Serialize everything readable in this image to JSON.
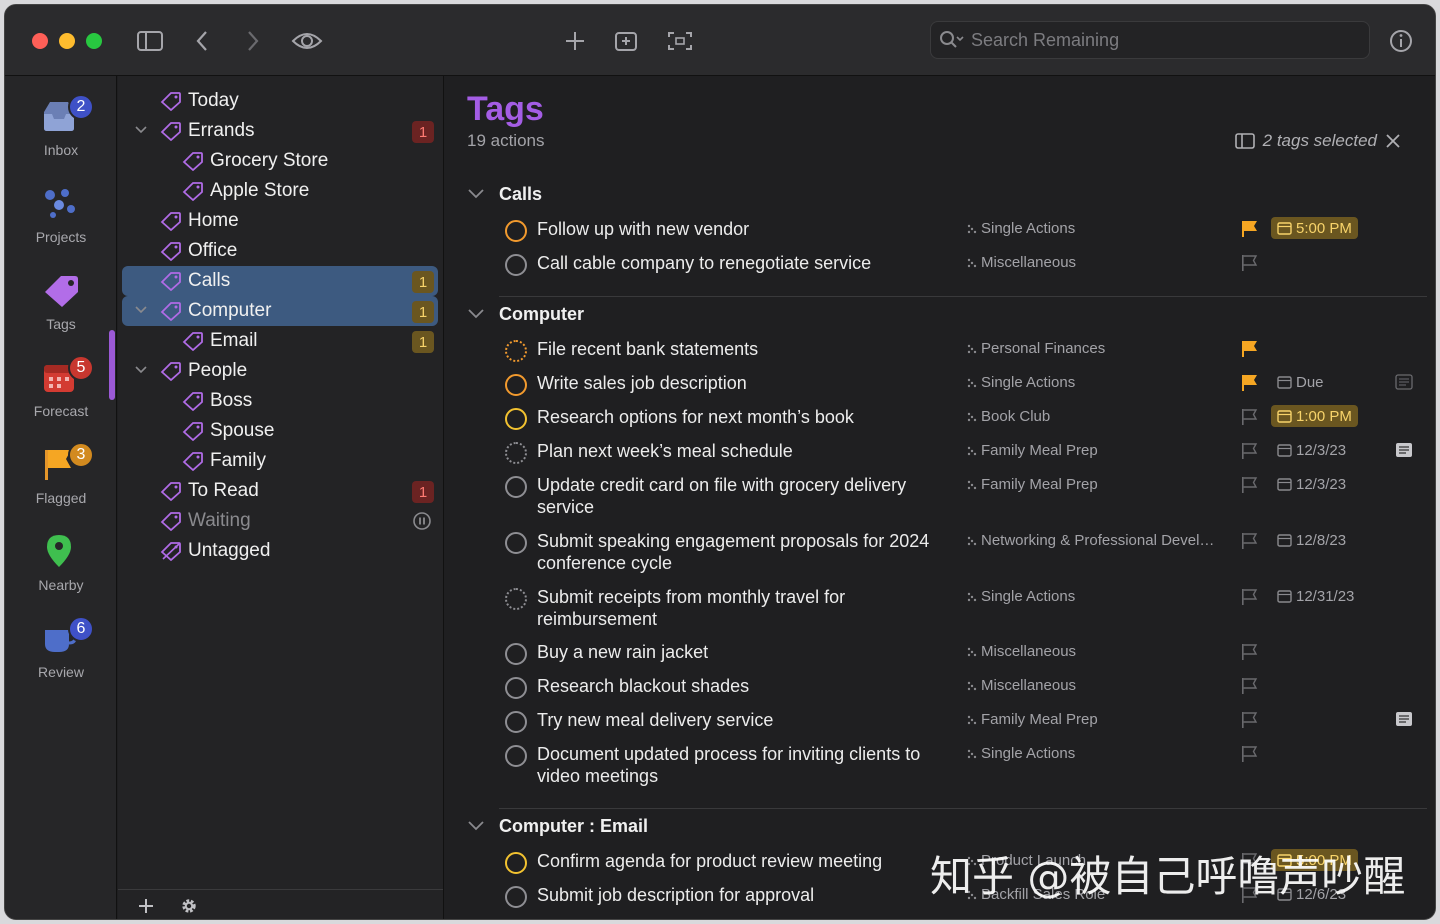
{
  "search": {
    "placeholder": "Search Remaining"
  },
  "rail": {
    "items": [
      {
        "label": "Inbox",
        "badge": "2",
        "badge_color": "#3f51c7",
        "icon": "inbox-icon"
      },
      {
        "label": "Projects",
        "badge": "",
        "icon": "projects-icon"
      },
      {
        "label": "Tags",
        "badge": "",
        "icon": "tag-icon"
      },
      {
        "label": "Forecast",
        "badge": "5",
        "badge_color": "#c8372f",
        "icon": "calendar-icon"
      },
      {
        "label": "Flagged",
        "badge": "3",
        "badge_color": "#d28a1f",
        "icon": "flag-icon"
      },
      {
        "label": "Nearby",
        "badge": "",
        "icon": "map-pin-icon"
      },
      {
        "label": "Review",
        "badge": "6",
        "badge_color": "#3f51c7",
        "icon": "review-icon"
      }
    ]
  },
  "sidebar": {
    "items": [
      {
        "label": "Today",
        "count": ""
      },
      {
        "label": "Errands",
        "count": "1"
      },
      {
        "label": "Grocery Store",
        "count": ""
      },
      {
        "label": "Apple Store",
        "count": ""
      },
      {
        "label": "Home",
        "count": ""
      },
      {
        "label": "Office",
        "count": ""
      },
      {
        "label": "Calls",
        "count": "1"
      },
      {
        "label": "Computer",
        "count": "1"
      },
      {
        "label": "Email",
        "count": "1"
      },
      {
        "label": "People",
        "count": ""
      },
      {
        "label": "Boss",
        "count": ""
      },
      {
        "label": "Spouse",
        "count": ""
      },
      {
        "label": "Family",
        "count": ""
      },
      {
        "label": "To Read",
        "count": "1"
      },
      {
        "label": "Waiting",
        "count": ""
      },
      {
        "label": "Untagged",
        "count": ""
      }
    ]
  },
  "main": {
    "title": "Tags",
    "subtitle": "19 actions",
    "selection": "2 tags selected",
    "groups": [
      {
        "name": "Calls",
        "tasks": [
          {
            "name": "Follow up with new vendor",
            "project": "Single Actions",
            "flagged": true,
            "due": "5:00 PM"
          },
          {
            "name": "Call cable company to renegotiate service",
            "project": "Miscellaneous",
            "flagged": false,
            "due": ""
          }
        ]
      },
      {
        "name": "Computer",
        "tasks": [
          {
            "name": "File recent bank statements",
            "project": "Personal Finances",
            "flagged": true,
            "due": ""
          },
          {
            "name": "Write sales job description",
            "project": "Single Actions",
            "flagged": true,
            "due": "Due"
          },
          {
            "name": "Research options for next month’s book",
            "project": "Book Club",
            "flagged": false,
            "due": "1:00 PM"
          },
          {
            "name": "Plan next week’s meal schedule",
            "project": "Family Meal Prep",
            "flagged": false,
            "due": "12/3/23"
          },
          {
            "name": "Update credit card on file with grocery delivery service",
            "project": "Family Meal Prep",
            "flagged": false,
            "due": "12/3/23"
          },
          {
            "name": "Submit speaking engagement proposals for 2024 conference cycle",
            "project": "Networking & Professional Devel…",
            "flagged": false,
            "due": "12/8/23"
          },
          {
            "name": "Submit receipts from monthly travel for reimbursement",
            "project": "Single Actions",
            "flagged": false,
            "due": "12/31/23"
          },
          {
            "name": "Buy a new rain jacket",
            "project": "Miscellaneous",
            "flagged": false,
            "due": ""
          },
          {
            "name": "Research blackout shades",
            "project": "Miscellaneous",
            "flagged": false,
            "due": ""
          },
          {
            "name": "Try new meal delivery service",
            "project": "Family Meal Prep",
            "flagged": false,
            "due": ""
          },
          {
            "name": "Document updated process for inviting clients to video meetings",
            "project": "Single Actions",
            "flagged": false,
            "due": ""
          }
        ]
      },
      {
        "name": "Computer : Email",
        "tasks": [
          {
            "name": "Confirm agenda for product review meeting",
            "project": "Product Launch",
            "flagged": false,
            "due": "5:00 PM"
          },
          {
            "name": "Submit job description for approval",
            "project": "Backfill Sales Role",
            "flagged": false,
            "due": "12/6/23"
          }
        ]
      }
    ]
  },
  "watermark": "知乎 @被自己呼噜声吵醒",
  "colors": {
    "accent": "#a45de5",
    "selection": "#3d5a80",
    "flag": "#f5a623"
  }
}
